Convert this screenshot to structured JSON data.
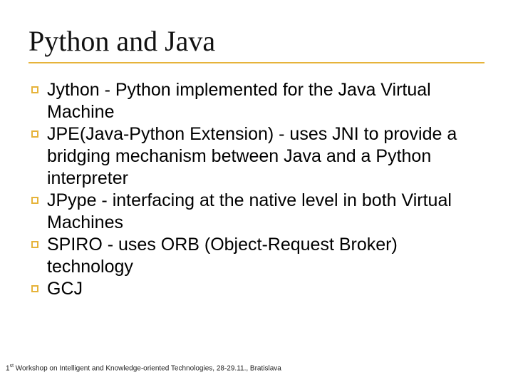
{
  "title": "Python and Java",
  "bullets": [
    "Jython - Python implemented for the Java Virtual Machine",
    "JPE(Java-Python Extension) - uses JNI to provide a bridging mechanism between Java and a Python interpreter",
    "JPype - interfacing at the native level in both Virtual Machines",
    "SPIRO - uses ORB (Object-Request Broker) technology",
    "GCJ"
  ],
  "footer": {
    "ord": "1",
    "sup": "st",
    "rest": " Workshop on Intelligent and Knowledge-oriented Technologies, 28-29.11., Bratislava"
  }
}
